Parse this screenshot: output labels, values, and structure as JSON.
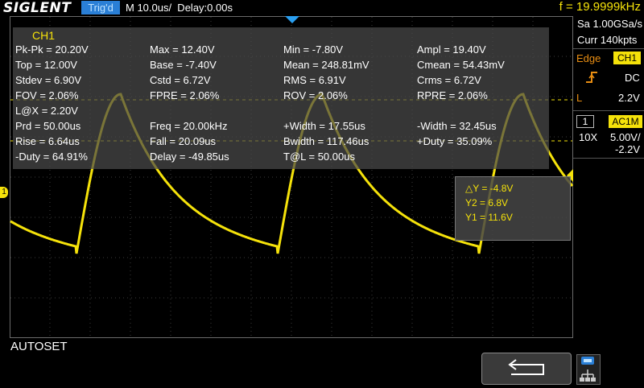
{
  "header": {
    "brand": "SIGLENT",
    "trigger_status": "Trig'd",
    "timebase": "M 10.0us/  Delay:0.00s",
    "frequency": "f = 19.9999kHz"
  },
  "acquisition": {
    "sample_rate": "Sa 1.00GSa/s",
    "memory": "Curr 140kpts"
  },
  "trigger": {
    "type": "Edge",
    "source": "CH1",
    "coupling": "DC",
    "level_prefix": "L",
    "level": "2.2V"
  },
  "channel": {
    "number": "1",
    "coupling_impedance": "AC1M",
    "probe": "10X",
    "scale": "5.00V/",
    "offset": "-2.2V",
    "marker": "1"
  },
  "measurements": {
    "title": "CH1",
    "rows": [
      [
        "Pk-Pk = 20.20V",
        "Max = 12.40V",
        "Min = -7.80V",
        "Ampl = 19.40V"
      ],
      [
        "Top = 12.00V",
        "Base = -7.40V",
        "Mean = 248.81mV",
        "Cmean = 54.43mV"
      ],
      [
        "Stdev = 6.90V",
        "Cstd = 6.72V",
        "RMS = 6.91V",
        "Crms = 6.72V"
      ],
      [
        "FOV = 2.06%",
        "FPRE = 2.06%",
        "ROV = 2.06%",
        "RPRE = 2.06%"
      ],
      [
        "L@X = 2.20V",
        "",
        "",
        ""
      ],
      [
        "Prd = 50.00us",
        "Freq = 20.00kHz",
        "+Width = 17.55us",
        "-Width = 32.45us"
      ],
      [
        "Rise = 6.64us",
        "Fall = 20.09us",
        "Bwidth = 117.46us",
        "+Duty = 35.09%"
      ],
      [
        "-Duty = 64.91%",
        "Delay = -49.85us",
        "T@L = 50.00us",
        ""
      ]
    ]
  },
  "cursors": {
    "delta_y": "△Y = -4.8V",
    "y2": "Y2 = 6.8V",
    "y1": "Y1 = 11.6V"
  },
  "footer": {
    "status": "AUTOSET"
  },
  "colors": {
    "trace": "#f5e20a",
    "accent_blue": "#2a7fd6",
    "menu_orange": "#e88d12"
  },
  "icons": [
    "trigger-position-marker-icon",
    "trigger-rising-edge-icon",
    "back-arrow-icon",
    "network-icon"
  ]
}
